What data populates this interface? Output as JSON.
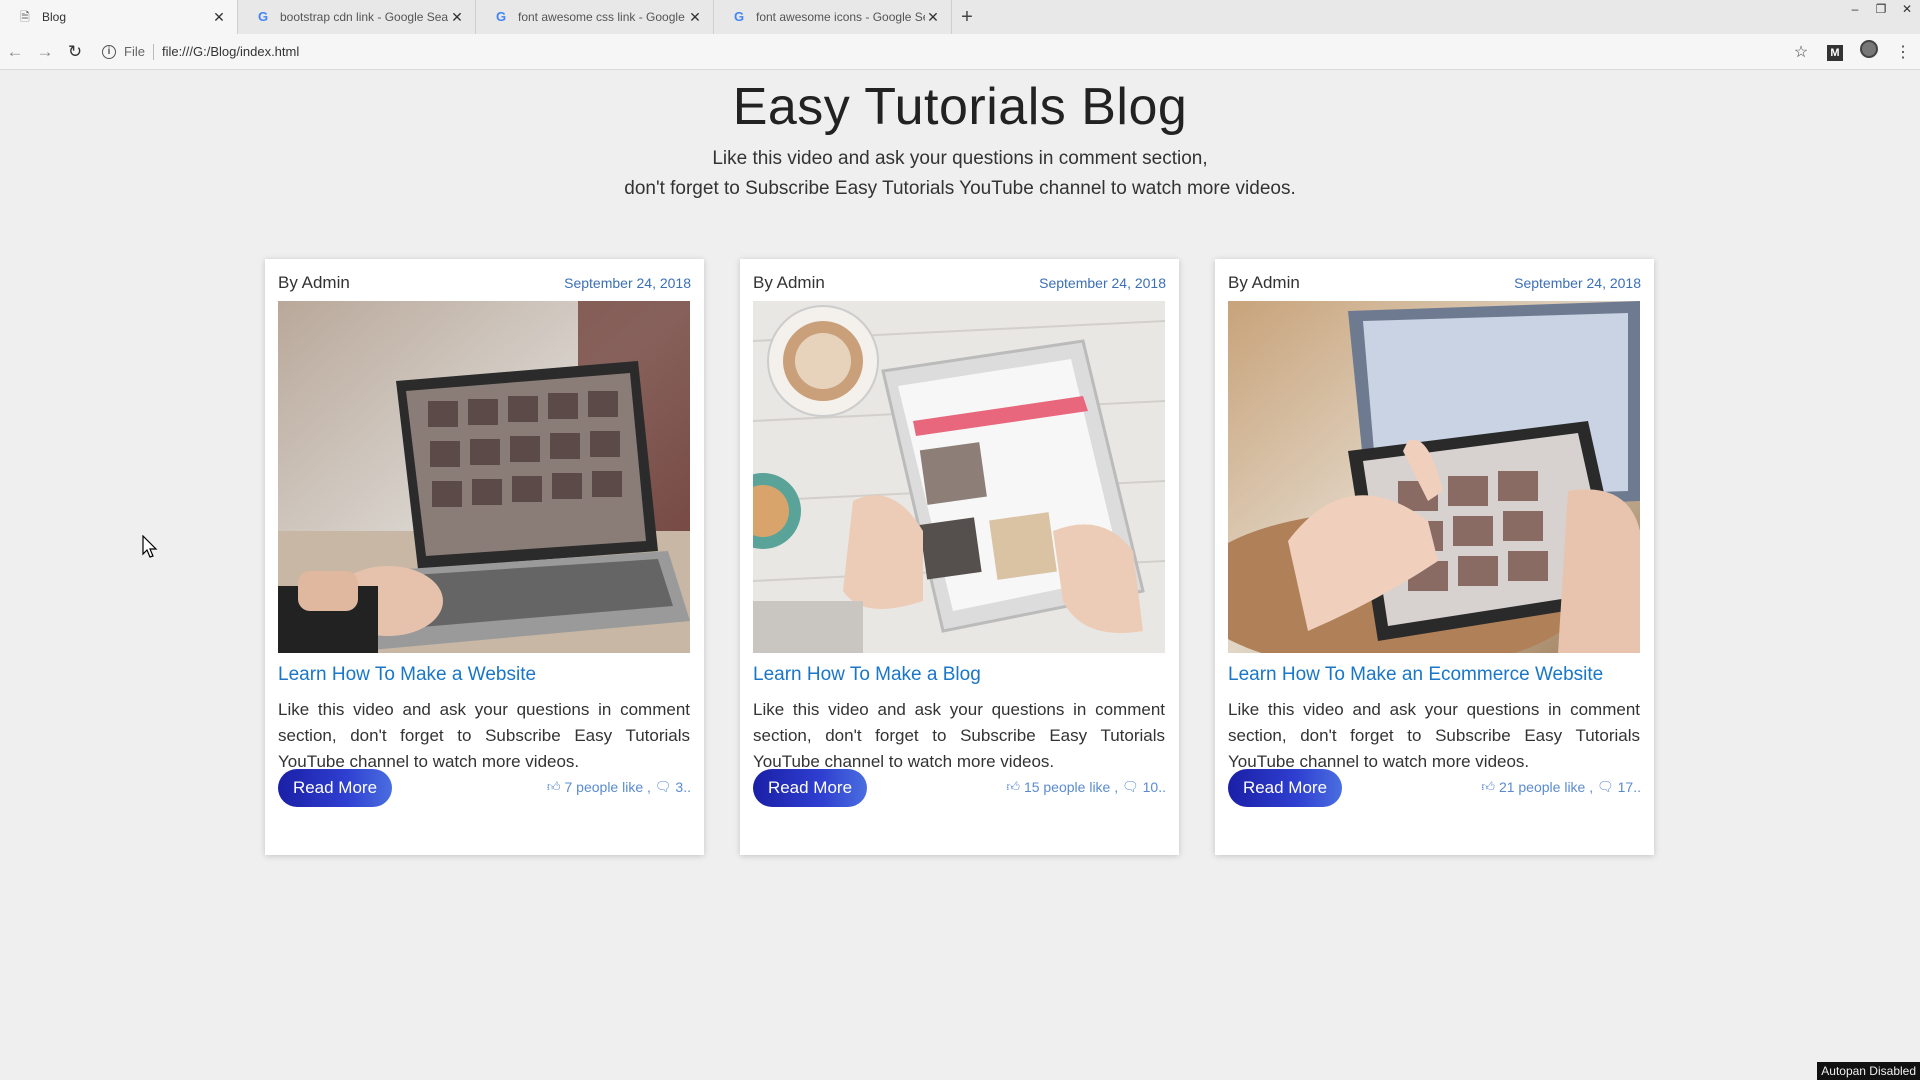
{
  "browser": {
    "tabs": [
      {
        "title": "Blog",
        "icon": "doc"
      },
      {
        "title": "bootstrap cdn link - Google Sea",
        "icon": "google"
      },
      {
        "title": "font awesome css link - Google",
        "icon": "google"
      },
      {
        "title": "font awesome icons - Google Se",
        "icon": "google"
      }
    ],
    "file_label": "File",
    "url": "file:///G:/Blog/index.html"
  },
  "page": {
    "title": "Easy Tutorials Blog",
    "subtitle_line1": "Like this video and ask your questions in comment section,",
    "subtitle_line2": "don't forget to Subscribe Easy Tutorials YouTube channel to watch more videos."
  },
  "cards": [
    {
      "author": "By Admin",
      "date": "September 24, 2018",
      "title": "Learn How To Make a Website",
      "text": "Like this video and ask your questions in comment section, don't forget to Subscribe Easy Tutorials YouTube channel to watch more videos.",
      "button": "Read More",
      "likes": "7 people like ,",
      "comments": "3..",
      "image": "laptop-photo"
    },
    {
      "author": "By Admin",
      "date": "September 24, 2018",
      "title": "Learn How To Make a Blog",
      "text": "Like this video and ask your questions in comment section, don't forget to Subscribe Easy Tutorials YouTube channel to watch more videos.",
      "button": "Read More",
      "likes": "15 people like ,",
      "comments": "10..",
      "image": "tablet-coffee-photo"
    },
    {
      "author": "By Admin",
      "date": "September 24, 2018",
      "title": "Learn How To Make an Ecommerce Website",
      "text": "Like this video and ask your questions in comment section, don't forget to Subscribe Easy Tutorials YouTube channel to watch more videos.",
      "button": "Read More",
      "likes": "21 people like ,",
      "comments": "17..",
      "image": "tablet-shopping-photo"
    }
  ],
  "overlay": {
    "autopan": "Autopan Disabled"
  },
  "colors": {
    "link": "#1976c9",
    "date": "#3b6fb6",
    "button_start": "#1a1fa6",
    "button_end": "#4a6ee0"
  }
}
